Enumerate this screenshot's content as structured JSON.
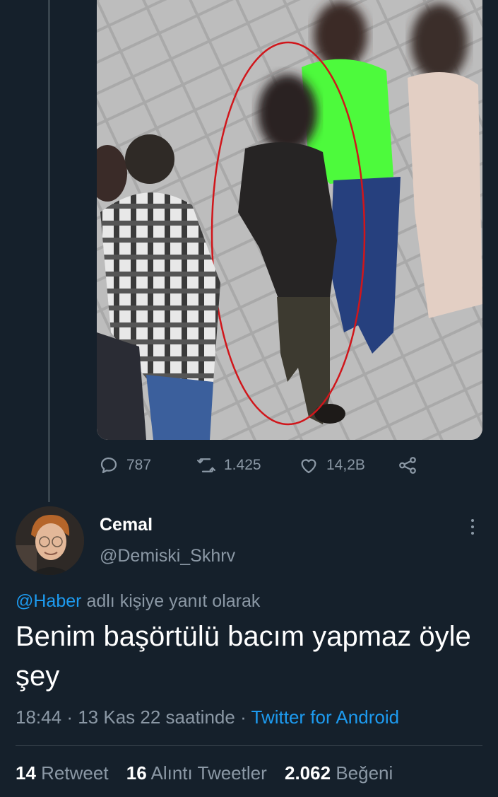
{
  "media": {
    "alt_icon": "cctv-photo"
  },
  "actions": {
    "reply_count": "787",
    "retweet_count": "1.425",
    "like_count": "14,2B"
  },
  "reply": {
    "display_name": "Cemal",
    "handle": "@Demiski_Skhrv",
    "replying_mention": "@Haber",
    "replying_suffix": "adlı kişiye yanıt olarak",
    "text": "Benim başörtülü bacım yapmaz öyle şey",
    "time": "18:44",
    "date": "13 Kas 22 saatinde",
    "separator": "·",
    "client": "Twitter for Android",
    "stats": {
      "retweets": "14",
      "retweets_label": "Retweet",
      "quotes": "16",
      "quotes_label": "Alıntı Tweetler",
      "likes": "2.062",
      "likes_label": "Beğeni"
    }
  },
  "colors": {
    "background": "#15202b",
    "accent": "#1d9bf0",
    "secondary_text": "#8b98a5",
    "divider": "#38444d"
  }
}
